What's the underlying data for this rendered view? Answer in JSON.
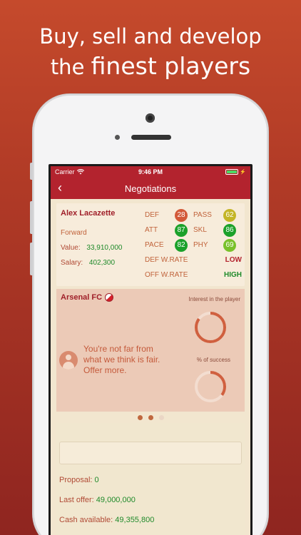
{
  "headline": {
    "line1": "Buy, sell and develop",
    "line2_prefix": "the",
    "line2_big": "finest players"
  },
  "statusbar": {
    "carrier": "Carrier",
    "time": "9:46 PM"
  },
  "navbar": {
    "title": "Negotiations"
  },
  "player": {
    "name": "Alex Lacazette",
    "position": "Forward",
    "value_label": "Value:",
    "value": "33,910,000",
    "salary_label": "Salary:",
    "salary": "402,300",
    "stats": [
      {
        "label": "DEF",
        "value": "28",
        "color": "#d35a39"
      },
      {
        "label": "PASS",
        "value": "62",
        "color": "#c4b526"
      },
      {
        "label": "ATT",
        "value": "87",
        "color": "#1ba12a"
      },
      {
        "label": "SKL",
        "value": "86",
        "color": "#1ba12a"
      },
      {
        "label": "PACE",
        "value": "82",
        "color": "#1ba12a"
      },
      {
        "label": "PHY",
        "value": "69",
        "color": "#79c12a"
      }
    ],
    "def_wrate_label": "DEF W.RATE",
    "def_wrate": "LOW",
    "off_wrate_label": "OFF W.RATE",
    "off_wrate": "HIGH"
  },
  "club": {
    "name": "Arsenal FC",
    "interest_label": "Interest in the player",
    "success_label": "% of success",
    "message": "You're not far from what we think is fair. Offer more.",
    "interest_level": 0.85,
    "success_level": 0.35
  },
  "pager": {
    "count": 3,
    "active": [
      0,
      1
    ]
  },
  "negotiation": {
    "proposal_label": "Proposal:",
    "proposal": "0",
    "last_offer_label": "Last offer:",
    "last_offer": "49,000,000",
    "cash_label": "Cash available:",
    "cash": "49,355,800"
  }
}
